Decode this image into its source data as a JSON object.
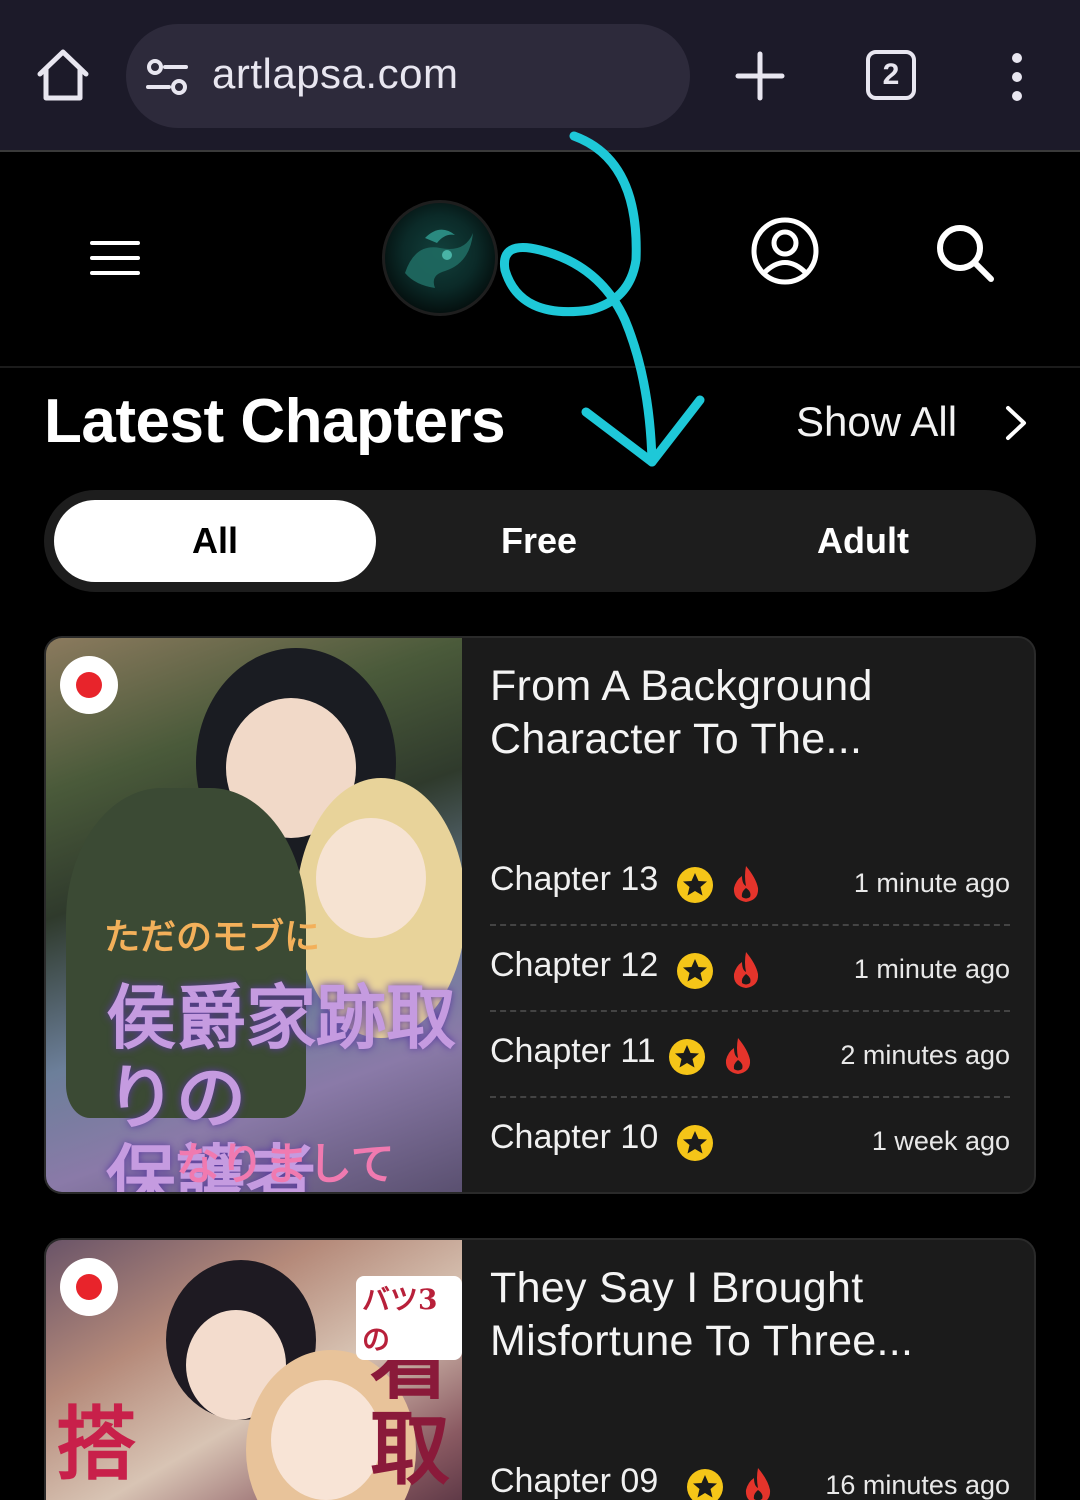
{
  "browser": {
    "url": "artlapsa.com",
    "tab_count": "2"
  },
  "section": {
    "title": "Latest Chapters",
    "show_all": "Show All"
  },
  "filters": [
    {
      "label": "All",
      "active": true
    },
    {
      "label": "Free",
      "active": false
    },
    {
      "label": "Adult",
      "active": false
    }
  ],
  "cards": [
    {
      "title": "From A Background Character To The...",
      "chapters": [
        {
          "name": "Chapter 13",
          "time": "1 minute ago",
          "star": true,
          "fire": true
        },
        {
          "name": "Chapter 12",
          "time": "1 minute ago",
          "star": true,
          "fire": true
        },
        {
          "name": "Chapter 11",
          "time": "2 minutes ago",
          "star": true,
          "fire": true
        },
        {
          "name": "Chapter 10",
          "time": "1 week ago",
          "star": true,
          "fire": false
        }
      ]
    },
    {
      "title": "They Say I Brought Misfortune To Three...",
      "chapters": [
        {
          "name": "Chapter 09",
          "time": "16 minutes ago",
          "star": true,
          "fire": true
        }
      ]
    }
  ],
  "colors": {
    "browser_bar": "#1c1a29",
    "accent_star": "#f5c518",
    "fire": "#e5342b",
    "annotation": "#1ec8d8"
  },
  "icons": [
    "home-icon",
    "site-settings-icon",
    "new-tab-icon",
    "tab-switcher-icon",
    "more-icon",
    "hamburger-icon",
    "user-icon",
    "search-icon",
    "chevron-right-icon",
    "star-icon",
    "fire-icon"
  ]
}
